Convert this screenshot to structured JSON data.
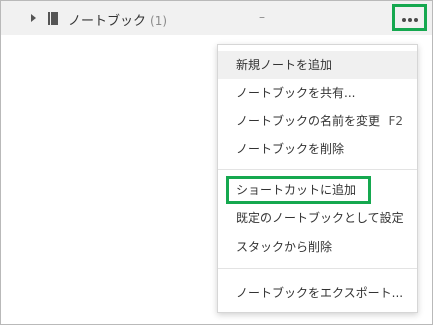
{
  "notebook": {
    "title": "ノートブック",
    "count": "(1)",
    "updated": "–"
  },
  "menu": {
    "items": [
      {
        "label": "新規ノートを追加"
      },
      {
        "label": "ノートブックを共有..."
      },
      {
        "label": "ノートブックの名前を変更",
        "shortcut": "F2"
      },
      {
        "label": "ノートブックを削除"
      },
      {
        "label": "ショートカットに追加"
      },
      {
        "label": "既定のノートブックとして設定"
      },
      {
        "label": "スタックから削除"
      },
      {
        "label": "ノートブックをエクスポート..."
      }
    ]
  },
  "icons": {
    "expand": "caret-right-icon",
    "notebook": "notebook-icon",
    "more": "more-horizontal-icon"
  },
  "colors": {
    "highlight_border": "#15a84f",
    "row_background": "#f1f1f1",
    "menu_hover": "#f0f0f0"
  }
}
